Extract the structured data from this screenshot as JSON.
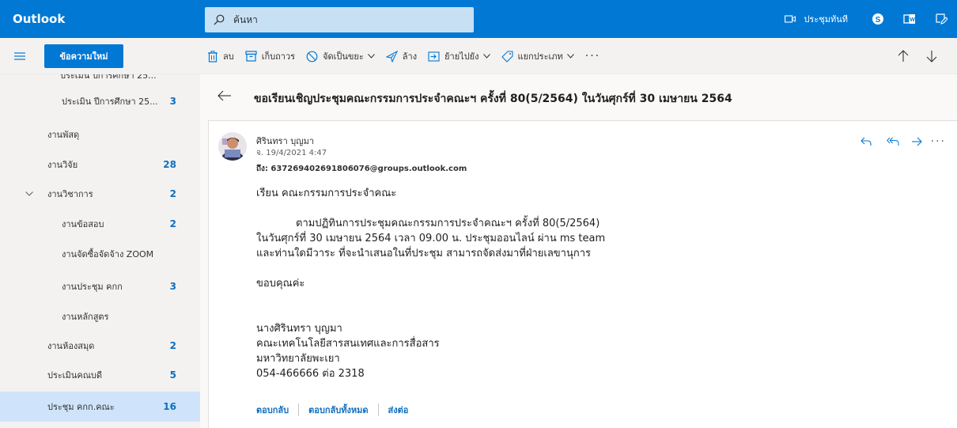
{
  "app": {
    "brand": "Outlook"
  },
  "search": {
    "placeholder": "ค้นหา"
  },
  "topbar": {
    "meet_now": "ประชุมทันที"
  },
  "command": {
    "new_message": "ข้อความใหม่",
    "delete": "ลบ",
    "archive": "เก็บถาวร",
    "junk": "จัดเป็นขยะ",
    "sweep": "ล้าง",
    "move_to": "ย้ายไปยัง",
    "categorize": "แยกประเภท",
    "more": "···"
  },
  "sidebar": {
    "cut_item": "ประเมิน ปีการศึกษา 25...",
    "items": [
      {
        "label": "ประเมิน ปีการศึกษา 25...",
        "count": "3"
      },
      {
        "label": "งานพัสดุ",
        "count": ""
      },
      {
        "label": "งานวิจัย",
        "count": "28"
      },
      {
        "label": "งานวิชาการ",
        "count": "2"
      },
      {
        "label": "งานข้อสอบ",
        "count": "2"
      },
      {
        "label": "งานจัดซื้อจัดจ้าง ZOOM",
        "count": ""
      },
      {
        "label": "งานประชุม คกก",
        "count": "3"
      },
      {
        "label": "งานหลักสูตร",
        "count": ""
      },
      {
        "label": "งานห้องสมุด",
        "count": "2"
      },
      {
        "label": "ประเมินคณบดี",
        "count": "5"
      },
      {
        "label": "ประชุม คกก.คณะ",
        "count": "16"
      }
    ]
  },
  "email": {
    "subject": "ขอเรียนเชิญประชุมคณะกรรมการประจำคณะฯ ครั้งที่ 80(5/2564) ในวันศุกร์ที่ 30 เมษายน 2564",
    "sender": "ศิรินทรา บุญมา",
    "date": "จ. 19/4/2021 4:47",
    "to_label": "ถึง:",
    "to": "637269402691806076@groups.outlook.com",
    "body": {
      "greeting": "เรียน คณะกรรมการประจำคณะ",
      "line1": "ตามปฏิทินการประชุมคณะกรรมการประจำคณะฯ ครั้งที่ 80(5/2564)",
      "line2": "ในวันศุกร์ที่ 30 เมษายน 2564 เวลา 09.00 น. ประชุมออนไลน์ ผ่าน ms team",
      "line3": "และท่านใดมีวาระ ที่จะนำเสนอในที่ประชุม สามารถจัดส่งมาที่ฝ่ายเลขานุการ",
      "thanks": "ขอบคุณค่ะ",
      "sig1": "นางศิรินทรา บุญมา",
      "sig2": "คณะเทคโนโลยีสารสนเทศและการสื่อสาร",
      "sig3": "มหาวิทยาลัยพะเยา",
      "sig4": "054-466666 ต่อ 2318"
    },
    "reply": "ตอบกลับ",
    "reply_all": "ตอบกลับทั้งหมด",
    "forward": "ส่งต่อ"
  },
  "colors": {
    "brand_blue": "#0078d4",
    "link_blue": "#106ebe",
    "selected_bg": "#cfe4fa"
  }
}
